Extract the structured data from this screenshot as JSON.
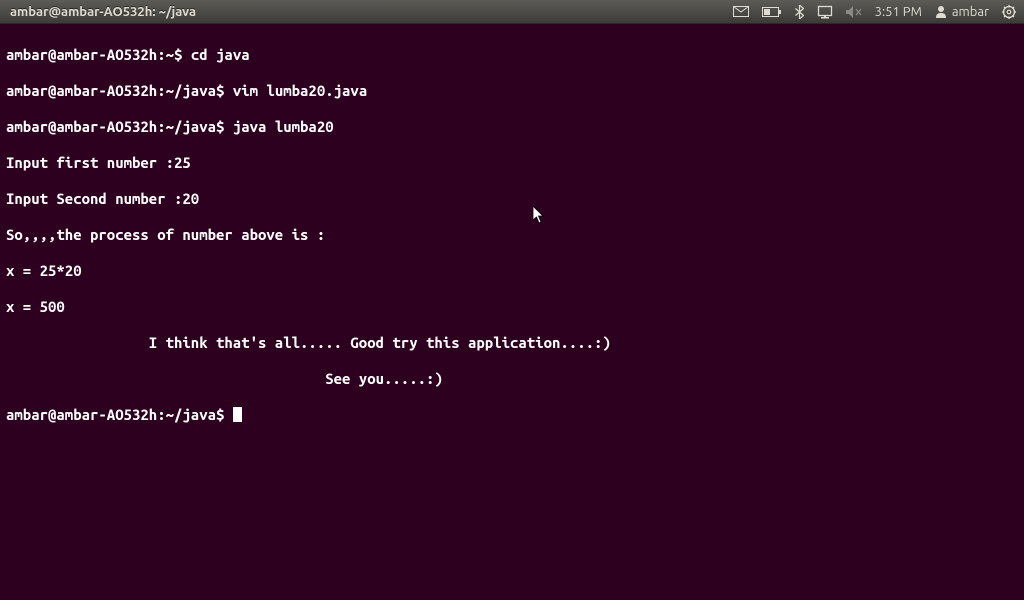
{
  "titlebar": {
    "title": "ambar@ambar-AO532h: ~/java"
  },
  "tray": {
    "clock": "3:51 PM",
    "user": "ambar"
  },
  "term": {
    "prompt1": "ambar@ambar-AO532h:~$ ",
    "cmd1": "cd java",
    "prompt2": "ambar@ambar-AO532h:~/java$ ",
    "cmd2": "vim lumba20.java",
    "prompt3": "ambar@ambar-AO532h:~/java$ ",
    "cmd3": "java lumba20",
    "out1": "Input first number :25",
    "out2": "Input Second number :20",
    "out3": "So,,,,the process of number above is :",
    "out4": "x = 25*20",
    "out5": "x = 500",
    "out6": "                 I think that's all..... Good try this application....:)",
    "out7": "                                      See you.....:)",
    "prompt4": "ambar@ambar-AO532h:~/java$ "
  }
}
